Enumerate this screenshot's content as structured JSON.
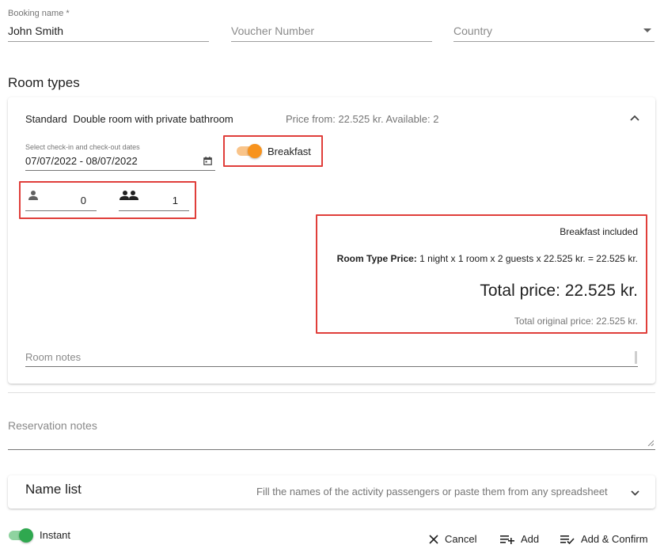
{
  "form": {
    "booking_name_label": "Booking name *",
    "booking_name_value": "John Smith",
    "voucher_placeholder": "Voucher Number",
    "country_placeholder": "Country"
  },
  "room_types": {
    "title": "Room types",
    "room": {
      "name": "Standard",
      "description": "Double room with private bathroom",
      "price_info": "Price from: 22.525 kr. Available: 2",
      "dates_label": "Select check-in and check-out dates",
      "dates_value": "07/07/2022 - 08/07/2022",
      "breakfast_label": "Breakfast",
      "breakfast_on": true,
      "single_count": "0",
      "double_count": "1",
      "breakfast_included": "Breakfast included",
      "room_type_price_label": "Room Type Price:",
      "room_type_price_value": "1 night x 1 room x 2 guests x 22.525 kr. = 22.525 kr.",
      "total_price": "Total price: 22.525 kr.",
      "total_original_price": "Total original price: 22.525 kr.",
      "room_notes_placeholder": "Room notes"
    }
  },
  "reservation_notes_placeholder": "Reservation notes",
  "name_list": {
    "title": "Name list",
    "hint": "Fill the names of the activity passengers or paste them from any spreadsheet"
  },
  "footer": {
    "instant_label": "Instant",
    "instant_on": true,
    "cancel_label": "Cancel",
    "add_label": "Add",
    "add_confirm_label": "Add & Confirm"
  },
  "colors": {
    "breakfast_toggle_knob": "#f7931e",
    "breakfast_toggle_track": "#f9c48a",
    "instant_toggle_knob": "#2fa84f",
    "instant_toggle_track": "#8fd3a0",
    "highlight": "#e03e3a"
  }
}
